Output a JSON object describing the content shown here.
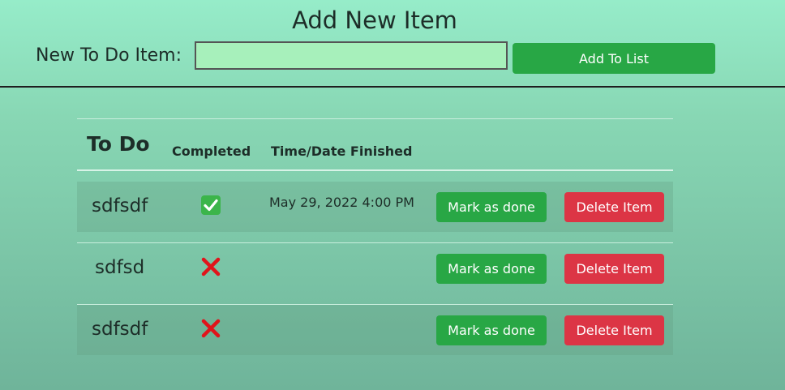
{
  "header": {
    "title": "Add New Item",
    "new_item_label": "New To Do Item:",
    "new_item_value": "",
    "add_button_label": "Add To List"
  },
  "table": {
    "columns": [
      "To Do",
      "Completed",
      "Time/Date Finished"
    ],
    "mark_done_label": "Mark as done",
    "delete_label": "Delete Item",
    "rows": [
      {
        "name": "sdfsdf",
        "completed": true,
        "status_icon": "check-mark-icon",
        "finished": "May 29, 2022 4:00 PM"
      },
      {
        "name": "sdfsd",
        "completed": false,
        "status_icon": "cross-mark-icon",
        "finished": ""
      },
      {
        "name": "sdfsdf",
        "completed": false,
        "status_icon": "cross-mark-icon",
        "finished": ""
      }
    ]
  },
  "colors": {
    "background_top": "#96ecc9",
    "background_bottom": "#6fb49a",
    "input_background": "#a7f0bb",
    "success": "#28a745",
    "danger": "#dc3545"
  }
}
